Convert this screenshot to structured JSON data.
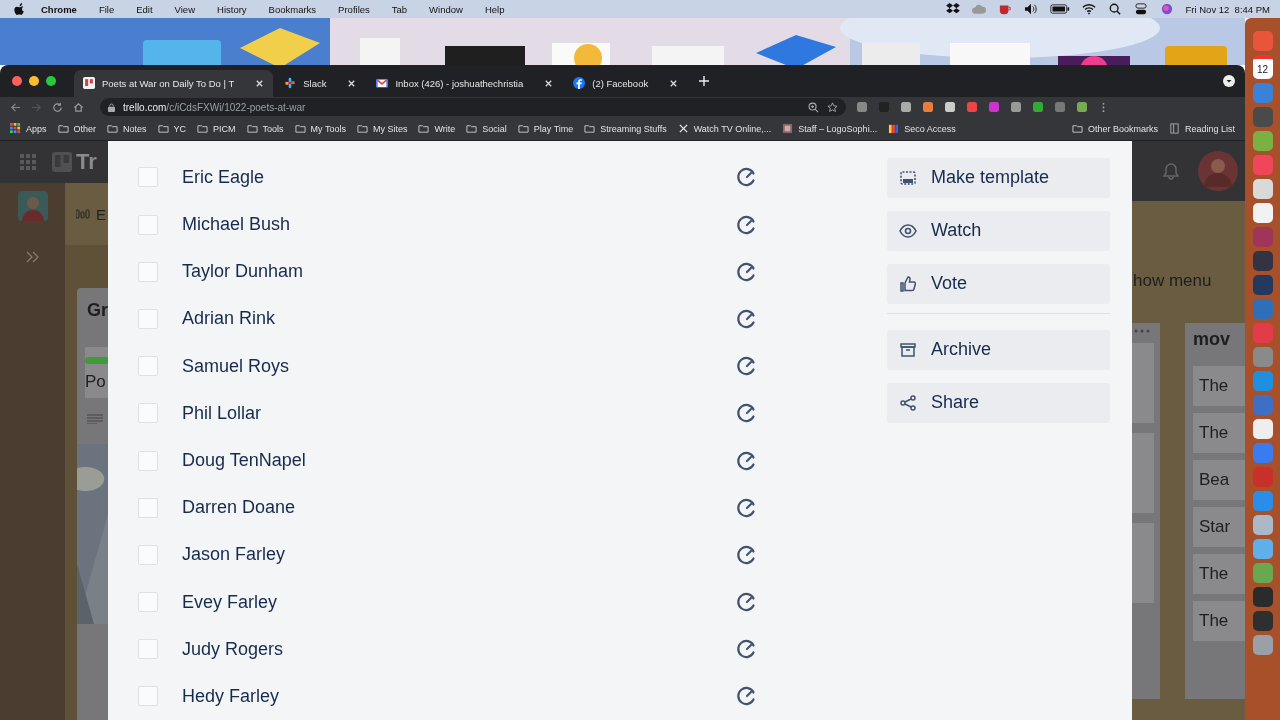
{
  "menubar": {
    "app": "Chrome",
    "menus": [
      "File",
      "Edit",
      "View",
      "History",
      "Bookmarks",
      "Profiles",
      "Tab",
      "Window",
      "Help"
    ],
    "clock": "Fri Nov 12  8:44 PM"
  },
  "tabs": [
    {
      "title": "Poets at War on Daily To Do | T",
      "kind": "trello",
      "selected": true
    },
    {
      "title": "Slack",
      "kind": "slack",
      "selected": false
    },
    {
      "title": "Inbox (426) - joshuathechristia",
      "kind": "gmail",
      "selected": false
    },
    {
      "title": "(2) Facebook",
      "kind": "facebook",
      "selected": false
    }
  ],
  "address": {
    "domain": "trello.com",
    "path": "/c/iCdsFXWi/1022-poets-at-war"
  },
  "bookmarks": [
    {
      "label": "Apps",
      "kind": "apps"
    },
    {
      "label": "Other",
      "kind": "folder"
    },
    {
      "label": "Notes",
      "kind": "folder"
    },
    {
      "label": "YC",
      "kind": "folder"
    },
    {
      "label": "PICM",
      "kind": "folder"
    },
    {
      "label": "Tools",
      "kind": "folder"
    },
    {
      "label": "My Tools",
      "kind": "folder"
    },
    {
      "label": "My Sites",
      "kind": "folder"
    },
    {
      "label": "Write",
      "kind": "folder"
    },
    {
      "label": "Social",
      "kind": "folder"
    },
    {
      "label": "Play Time",
      "kind": "folder"
    },
    {
      "label": "Streaming Stuffs",
      "kind": "folder"
    },
    {
      "label": "Watch TV Online,...",
      "kind": "x"
    },
    {
      "label": "Staff – LogoSophi..."
    },
    {
      "label": "Seco Access",
      "kind": "bars"
    }
  ],
  "bookmarks_right": [
    {
      "label": "Other Bookmarks",
      "kind": "folder"
    },
    {
      "label": "Reading List",
      "kind": "reading"
    }
  ],
  "board_left": {
    "logo_text": "Tr",
    "board_title": "E",
    "list_title": "Gr",
    "card_title": "Po"
  },
  "board_right": {
    "menu_link": "how menu",
    "list_title": "mov",
    "cards": [
      "The",
      "The",
      "Bea",
      "Star",
      "The",
      "The"
    ]
  },
  "checklist": [
    {
      "name": "Eric Eagle",
      "checked": false
    },
    {
      "name": "Michael Bush",
      "checked": false
    },
    {
      "name": "Taylor Dunham",
      "checked": false
    },
    {
      "name": "Adrian Rink",
      "checked": false
    },
    {
      "name": "Samuel Roys",
      "checked": false
    },
    {
      "name": "Phil Lollar",
      "checked": false
    },
    {
      "name": "Doug TenNapel",
      "checked": false
    },
    {
      "name": "Darren Doane",
      "checked": false
    },
    {
      "name": "Jason Farley",
      "checked": false
    },
    {
      "name": "Evey Farley",
      "checked": false
    },
    {
      "name": "Judy Rogers",
      "checked": false
    },
    {
      "name": "Hedy Farley",
      "checked": false
    }
  ],
  "actions": [
    {
      "label": "Make template",
      "kind": "template"
    },
    {
      "label": "Watch",
      "kind": "eye"
    },
    {
      "label": "Vote",
      "kind": "thumb"
    }
  ],
  "actions_2": [
    {
      "label": "Archive",
      "kind": "archive"
    },
    {
      "label": "Share",
      "kind": "share"
    }
  ],
  "dock": {
    "calendar_day": "12"
  }
}
